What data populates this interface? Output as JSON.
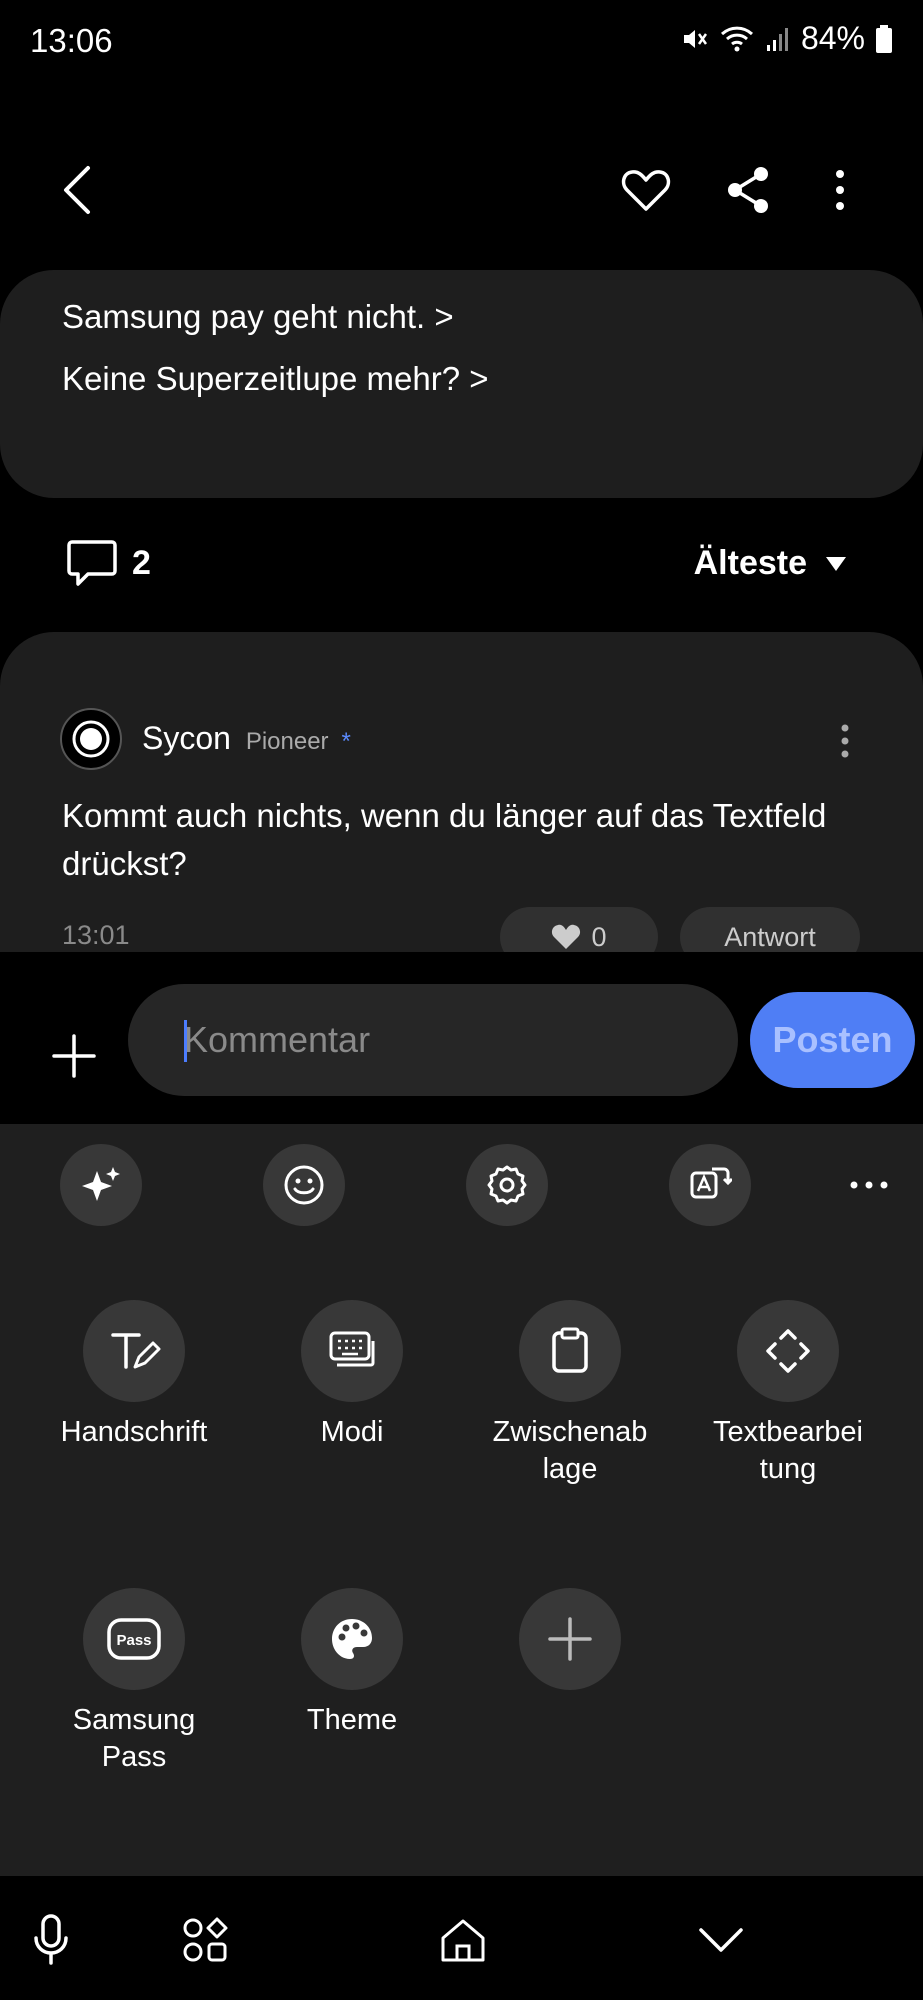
{
  "status_bar": {
    "time": "13:06",
    "battery": "84%"
  },
  "header": {
    "icons": {
      "back": "back-arrow-icon",
      "like": "heart-icon",
      "share": "share-icon",
      "more": "more-vertical-icon"
    }
  },
  "related": {
    "links": [
      "Samsung pay geht nicht. >",
      "Keine Superzeitlupe mehr? >"
    ]
  },
  "comments": {
    "count": "2",
    "sort_label": "Älteste"
  },
  "comment": {
    "author": "Sycon",
    "rank": "Pioneer",
    "rank_mark": "*",
    "text": "Kommt auch nichts, wenn du länger auf das Textfeld drückst?",
    "time": "13:01",
    "likes": "0",
    "reply_label": "Antwort"
  },
  "composer": {
    "placeholder": "Kommentar",
    "post_label": "Posten"
  },
  "keyboard": {
    "toolbar_icons": [
      "sparkle-icon",
      "emoji-icon",
      "settings-icon",
      "translate-icon",
      "more-horizontal-icon"
    ],
    "items": [
      {
        "label": "Handschrift",
        "icon": "handwriting-icon"
      },
      {
        "label": "Modi",
        "icon": "keyboard-modes-icon"
      },
      {
        "label": "Zwischenab\nlage",
        "icon": "clipboard-icon"
      },
      {
        "label": "Textbearbei\ntung",
        "icon": "text-editing-icon"
      },
      {
        "label": "Samsung\nPass",
        "icon": "samsung-pass-icon"
      },
      {
        "label": "Theme",
        "icon": "palette-icon"
      },
      {
        "label": "",
        "icon": "add-icon"
      }
    ]
  },
  "nav_bar": {
    "icons": [
      "microphone-icon",
      "apps-icon",
      "home-icon",
      "hide-keyboard-icon"
    ]
  },
  "colors": {
    "accent": "#4f7ef5",
    "card": "#1e1e1e",
    "panel": "#1f1f1f"
  }
}
